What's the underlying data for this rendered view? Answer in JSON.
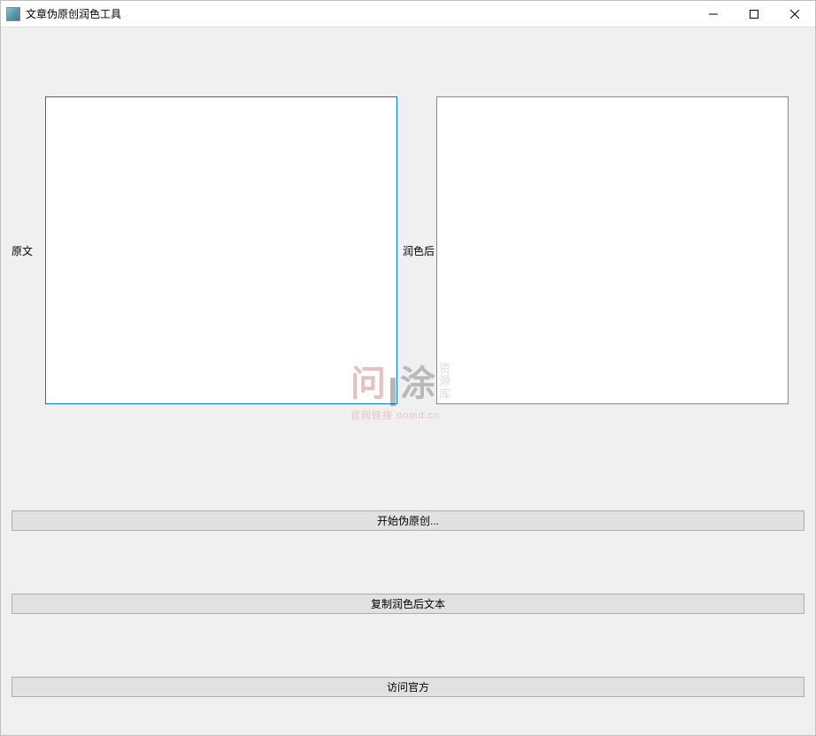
{
  "window": {
    "title": "文章伪原创润色工具"
  },
  "panels": {
    "left_label": "原文",
    "right_label": "润色后",
    "left_value": "",
    "right_value": ""
  },
  "buttons": {
    "start": "开始伪原创...",
    "copy": "复制润色后文本",
    "visit": "访问官方"
  },
  "watermark": {
    "char1": "问",
    "char2": "涂",
    "side1": "资",
    "side2": "源",
    "side3": "库",
    "url_label": "官网链接",
    "url": "oomd.cn"
  }
}
